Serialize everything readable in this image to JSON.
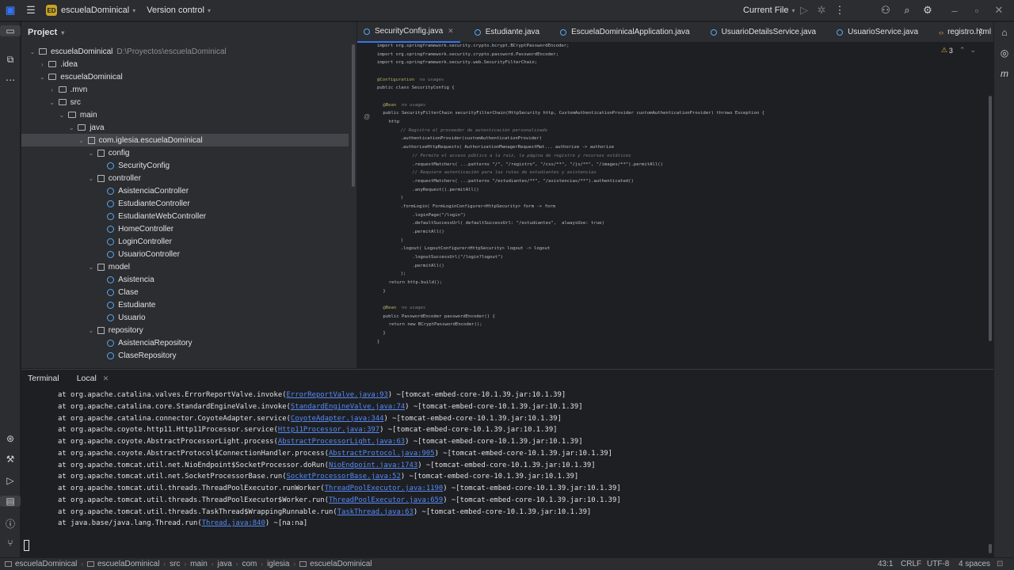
{
  "titlebar": {
    "project_badge": "ED",
    "project_name": "escuelaDominical",
    "vcs": "Version control",
    "run_config": "Current File"
  },
  "project_panel": {
    "title": "Project",
    "tree": [
      {
        "label": "escuelaDominical",
        "extra": "D:\\Proyectos\\escuelaDominical",
        "level": 0,
        "kind": "folder",
        "expanded": true
      },
      {
        "label": ".idea",
        "level": 1,
        "kind": "folder",
        "expanded": false
      },
      {
        "label": "escuelaDominical",
        "level": 1,
        "kind": "folder",
        "expanded": true
      },
      {
        "label": ".mvn",
        "level": 2,
        "kind": "folder",
        "expanded": false
      },
      {
        "label": "src",
        "level": 2,
        "kind": "folder",
        "expanded": true
      },
      {
        "label": "main",
        "level": 3,
        "kind": "folder",
        "expanded": true
      },
      {
        "label": "java",
        "level": 4,
        "kind": "folder",
        "expanded": true
      },
      {
        "label": "com.iglesia.escuelaDominical",
        "level": 5,
        "kind": "package",
        "expanded": true,
        "selected": true
      },
      {
        "label": "config",
        "level": 6,
        "kind": "package",
        "expanded": true
      },
      {
        "label": "SecurityConfig",
        "level": 7,
        "kind": "class"
      },
      {
        "label": "controller",
        "level": 6,
        "kind": "package",
        "expanded": true
      },
      {
        "label": "AsistenciaController",
        "level": 7,
        "kind": "class"
      },
      {
        "label": "EstudianteController",
        "level": 7,
        "kind": "class"
      },
      {
        "label": "EstudianteWebController",
        "level": 7,
        "kind": "class"
      },
      {
        "label": "HomeController",
        "level": 7,
        "kind": "class"
      },
      {
        "label": "LoginController",
        "level": 7,
        "kind": "class"
      },
      {
        "label": "UsuarioController",
        "level": 7,
        "kind": "class"
      },
      {
        "label": "model",
        "level": 6,
        "kind": "package",
        "expanded": true
      },
      {
        "label": "Asistencia",
        "level": 7,
        "kind": "class"
      },
      {
        "label": "Clase",
        "level": 7,
        "kind": "class"
      },
      {
        "label": "Estudiante",
        "level": 7,
        "kind": "class"
      },
      {
        "label": "Usuario",
        "level": 7,
        "kind": "class"
      },
      {
        "label": "repository",
        "level": 6,
        "kind": "package",
        "expanded": true
      },
      {
        "label": "AsistenciaRepository",
        "level": 7,
        "kind": "class"
      },
      {
        "label": "ClaseRepository",
        "level": 7,
        "kind": "class"
      }
    ]
  },
  "editor_tabs": [
    {
      "label": "SecurityConfig.java",
      "kind": "java",
      "active": true
    },
    {
      "label": "Estudiante.java",
      "kind": "java"
    },
    {
      "label": "EscuelaDominicalApplication.java",
      "kind": "java"
    },
    {
      "label": "UsuarioDetailsService.java",
      "kind": "java"
    },
    {
      "label": "UsuarioService.java",
      "kind": "java"
    },
    {
      "label": "registro.html",
      "kind": "html"
    }
  ],
  "editor": {
    "warnings": "3",
    "lines": [
      {
        "i": 0,
        "t": "import org.springframework.security.crypto.bcrypt.BCryptPasswordEncoder;"
      },
      {
        "i": 0,
        "t": "import org.springframework.security.crypto.password.PasswordEncoder;"
      },
      {
        "i": 0,
        "t": "import org.springframework.security.web.SecurityFilterChain;"
      },
      {
        "i": 0,
        "t": ""
      },
      {
        "i": 0,
        "t": "@Configuration",
        "c": "ann",
        "u": "no usages"
      },
      {
        "i": 0,
        "t": "public class SecurityConfig {"
      },
      {
        "i": 0,
        "t": ""
      },
      {
        "i": 1,
        "t": "@Bean",
        "c": "ann",
        "u": "no usages"
      },
      {
        "i": 1,
        "t": "public SecurityFilterChain securityFilterChain(HttpSecurity http, CustomAuthenticationProvider customAuthenticationProvider) throws Exception {"
      },
      {
        "i": 2,
        "t": "http"
      },
      {
        "i": 4,
        "t": "// Registra el proveedor de autenticación personalizado",
        "c": "cm"
      },
      {
        "i": 4,
        "t": ".authenticationProvider(customAuthenticationProvider)"
      },
      {
        "i": 4,
        "t": ".authorizeHttpRequests( AuthorizationManagerRequestMat... authorize -> authorize"
      },
      {
        "i": 6,
        "t": "// Permite el acceso público a la raíz, la página de registro y recursos estáticos",
        "c": "cm"
      },
      {
        "i": 6,
        "t": ".requestMatchers( ...patterns \"/\", \"/registro\", \"/css/**\", \"/js/**\", \"/images/**\").permitAll()"
      },
      {
        "i": 6,
        "t": "// Requiere autenticación para las rutas de estudiantes y asistencias",
        "c": "cm"
      },
      {
        "i": 6,
        "t": ".requestMatchers( ...patterns \"/estudiantes/**\", \"/asistencias/**\").authenticated()"
      },
      {
        "i": 6,
        "t": ".anyRequest().permitAll()"
      },
      {
        "i": 4,
        "t": ")"
      },
      {
        "i": 4,
        "t": ".formLogin( FormLoginConfigurer<HttpSecurity> form -> form"
      },
      {
        "i": 6,
        "t": ".loginPage(\"/login\")"
      },
      {
        "i": 6,
        "t": ".defaultSuccessUrl( defaultSuccessUrl: \"/estudiantes\",  alwaysUse: true)"
      },
      {
        "i": 6,
        "t": ".permitAll()"
      },
      {
        "i": 4,
        "t": ")"
      },
      {
        "i": 4,
        "t": ".logout( LogoutConfigurer<HttpSecurity> logout -> logout"
      },
      {
        "i": 6,
        "t": ".logoutSuccessUrl(\"/login?logout\")"
      },
      {
        "i": 6,
        "t": ".permitAll()"
      },
      {
        "i": 4,
        "t": ");"
      },
      {
        "i": 2,
        "t": "return http.build();"
      },
      {
        "i": 1,
        "t": "}"
      },
      {
        "i": 0,
        "t": ""
      },
      {
        "i": 1,
        "t": "@Bean",
        "c": "ann",
        "u": "no usages"
      },
      {
        "i": 1,
        "t": "public PasswordEncoder passwordEncoder() {"
      },
      {
        "i": 2,
        "t": "return new BCryptPasswordEncoder();"
      },
      {
        "i": 1,
        "t": "}"
      },
      {
        "i": 0,
        "t": "}"
      }
    ]
  },
  "terminal": {
    "tabs": [
      "Terminal",
      "Local"
    ],
    "lines": [
      {
        "pre": "at org.apache.catalina.valves.ErrorReportValve.invoke(",
        "link": "ErrorReportValve.java:93",
        "post": ") ~[tomcat-embed-core-10.1.39.jar:10.1.39]"
      },
      {
        "pre": "at org.apache.catalina.core.StandardEngineValve.invoke(",
        "link": "StandardEngineValve.java:74",
        "post": ") ~[tomcat-embed-core-10.1.39.jar:10.1.39]"
      },
      {
        "pre": "at org.apache.catalina.connector.CoyoteAdapter.service(",
        "link": "CoyoteAdapter.java:344",
        "post": ") ~[tomcat-embed-core-10.1.39.jar:10.1.39]"
      },
      {
        "pre": "at org.apache.coyote.http11.Http11Processor.service(",
        "link": "Http11Processor.java:397",
        "post": ") ~[tomcat-embed-core-10.1.39.jar:10.1.39]"
      },
      {
        "pre": "at org.apache.coyote.AbstractProcessorLight.process(",
        "link": "AbstractProcessorLight.java:63",
        "post": ") ~[tomcat-embed-core-10.1.39.jar:10.1.39]"
      },
      {
        "pre": "at org.apache.coyote.AbstractProtocol$ConnectionHandler.process(",
        "link": "AbstractProtocol.java:905",
        "post": ") ~[tomcat-embed-core-10.1.39.jar:10.1.39]"
      },
      {
        "pre": "at org.apache.tomcat.util.net.NioEndpoint$SocketProcessor.doRun(",
        "link": "NioEndpoint.java:1743",
        "post": ") ~[tomcat-embed-core-10.1.39.jar:10.1.39]"
      },
      {
        "pre": "at org.apache.tomcat.util.net.SocketProcessorBase.run(",
        "link": "SocketProcessorBase.java:52",
        "post": ") ~[tomcat-embed-core-10.1.39.jar:10.1.39]"
      },
      {
        "pre": "at org.apache.tomcat.util.threads.ThreadPoolExecutor.runWorker(",
        "link": "ThreadPoolExecutor.java:1190",
        "post": ") ~[tomcat-embed-core-10.1.39.jar:10.1.39]"
      },
      {
        "pre": "at org.apache.tomcat.util.threads.ThreadPoolExecutor$Worker.run(",
        "link": "ThreadPoolExecutor.java:659",
        "post": ") ~[tomcat-embed-core-10.1.39.jar:10.1.39]"
      },
      {
        "pre": "at org.apache.tomcat.util.threads.TaskThread$WrappingRunnable.run(",
        "link": "TaskThread.java:63",
        "post": ") ~[tomcat-embed-core-10.1.39.jar:10.1.39]"
      },
      {
        "pre": "at java.base/java.lang.Thread.run(",
        "link": "Thread.java:840",
        "post": ") ~[na:na]"
      }
    ]
  },
  "statusbar": {
    "breadcrumbs": [
      "escuelaDominical",
      "escuelaDominical",
      "src",
      "main",
      "java",
      "com",
      "iglesia",
      "escuelaDominical"
    ],
    "position": "43:1",
    "line_sep": "CRLF",
    "encoding": "UTF-8",
    "indent": "4 spaces"
  },
  "colors": {
    "accent": "#3574f0",
    "link": "#548af7",
    "keyword": "#cf8e6d",
    "annotation": "#b3ae60",
    "string": "#6aab73"
  }
}
